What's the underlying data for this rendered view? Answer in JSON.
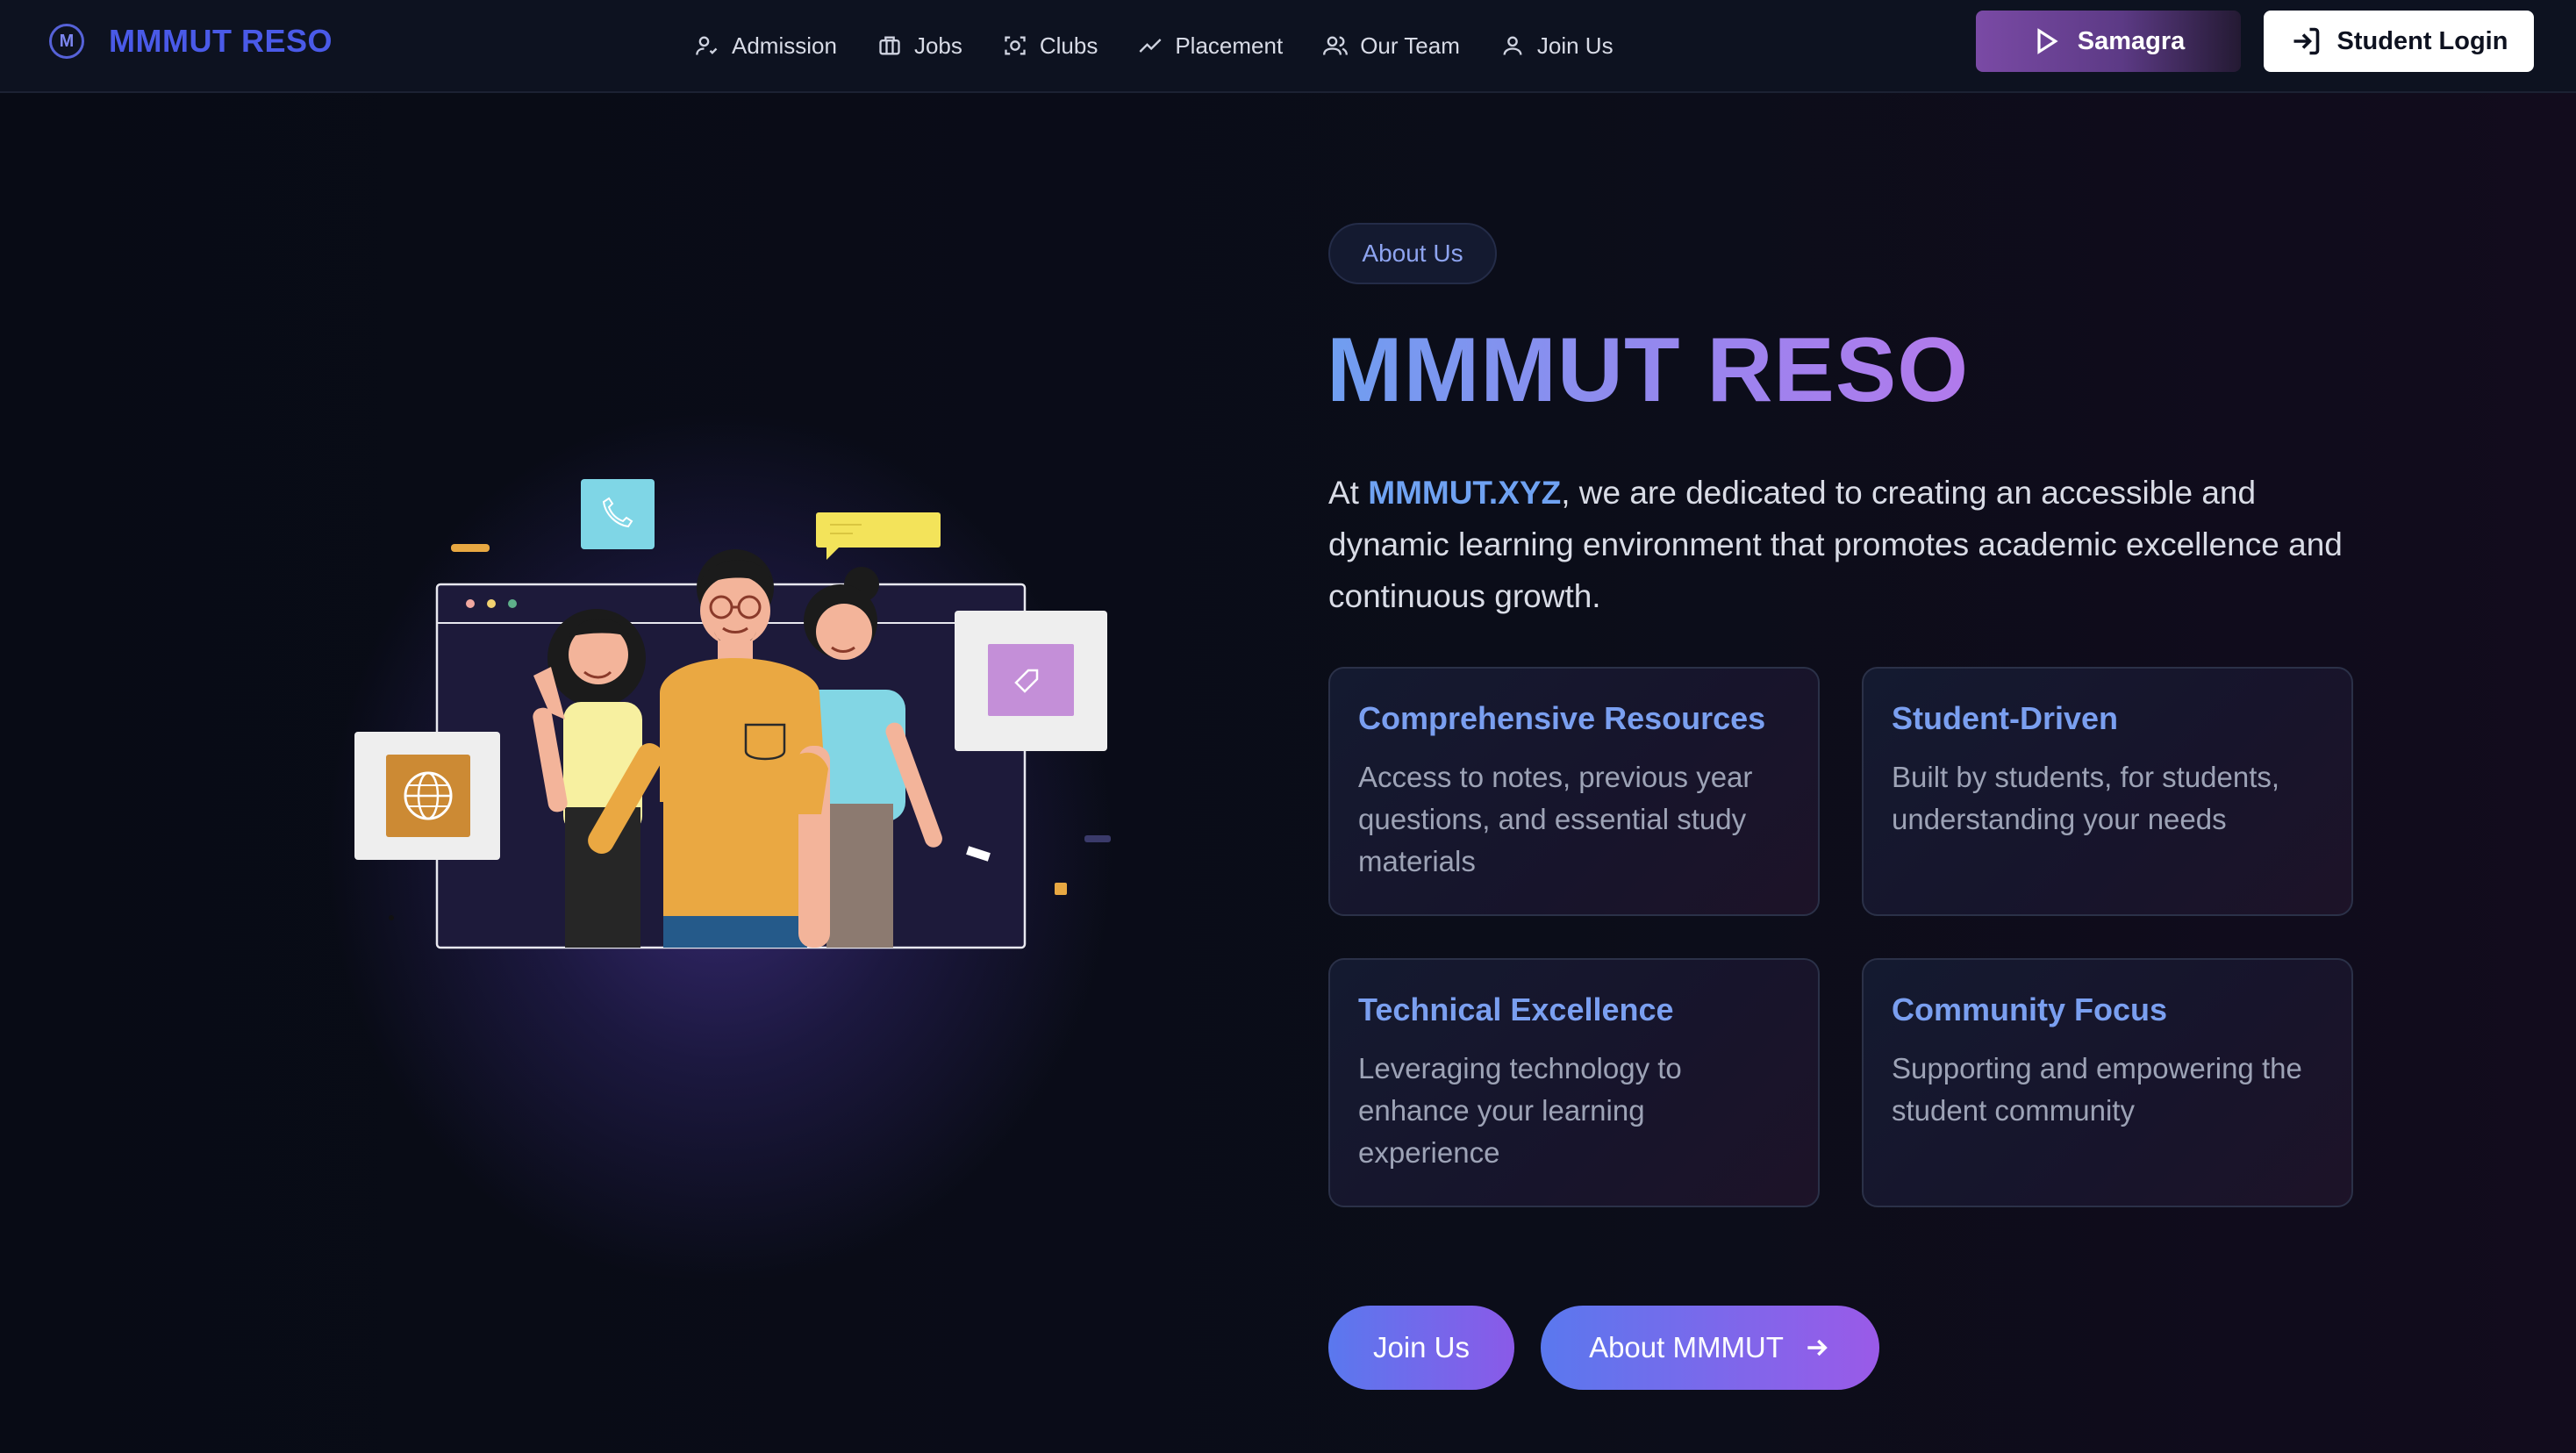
{
  "nav": {
    "brand_logo_letter": "M",
    "brand_name": "MMMUT RESO",
    "links": [
      {
        "label": "Admission",
        "icon": "user-check-icon"
      },
      {
        "label": "Jobs",
        "icon": "briefcase-icon"
      },
      {
        "label": "Clubs",
        "icon": "scan-face-icon"
      },
      {
        "label": "Placement",
        "icon": "trending-up-icon"
      },
      {
        "label": "Our Team",
        "icon": "users-icon"
      },
      {
        "label": "Join Us",
        "icon": "user-icon"
      }
    ],
    "samagra_label": "Samagra",
    "login_label": "Student Login"
  },
  "hero": {
    "badge": "About Us",
    "title": "MMMUT RESO",
    "desc_prefix": "At ",
    "desc_highlight": "MMMUT.XYZ",
    "desc_rest": ", we are dedicated to creating an accessible and dynamic learning environment that promotes academic excellence and continuous growth.",
    "cards": [
      {
        "title": "Comprehensive Resources",
        "text": "Access to notes, previous year questions, and essential study materials"
      },
      {
        "title": "Student-Driven",
        "text": "Built by students, for students, understanding your needs"
      },
      {
        "title": "Technical Excellence",
        "text": "Leveraging technology to enhance your learning experience"
      },
      {
        "title": "Community Focus",
        "text": "Supporting and empowering the student community"
      }
    ],
    "join_label": "Join Us",
    "about_label": "About MMMUT"
  },
  "colors": {
    "brand": "#4a5ae8",
    "accent": "#7a9ff0",
    "gradient_start": "#5a78ee",
    "gradient_end": "#9a5ae8"
  }
}
